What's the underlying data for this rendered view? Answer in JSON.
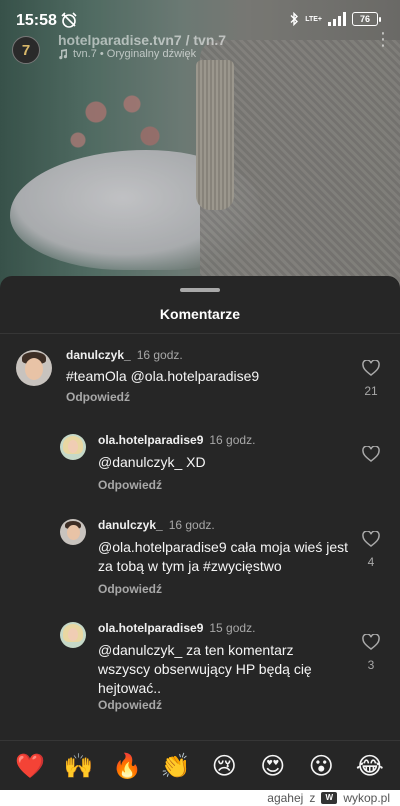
{
  "status_bar": {
    "time": "15:58",
    "network": "LTE+",
    "battery": "76"
  },
  "video": {
    "channel_badge": "7",
    "title": "hotelparadise.tvn7 / tvn.7",
    "sound_label": "tvn.7 • Oryginalny dźwięk"
  },
  "sheet": {
    "title": "Komentarze"
  },
  "comments": [
    {
      "username": "danulczyk_",
      "time": "16 godz.",
      "text": "#teamOla @ola.hotelparadise9",
      "reply_label": "Odpowiedź",
      "likes": "21"
    },
    {
      "username": "ola.hotelparadise9",
      "time": "16 godz.",
      "text": "@danulczyk_  XD",
      "reply_label": "Odpowiedź",
      "likes": ""
    },
    {
      "username": "danulczyk_",
      "time": "16 godz.",
      "text": "@ola.hotelparadise9 cała moja wieś jest za tobą w tym ja #zwycięstwo",
      "reply_label": "Odpowiedź",
      "likes": "4"
    },
    {
      "username": "ola.hotelparadise9",
      "time": "15 godz.",
      "text": "@danulczyk_ za ten komentarz wszyscy obserwujący HP będą cię hejtować..",
      "reply_label": "Odpowiedź",
      "likes": "3"
    }
  ],
  "emoji_bar": [
    "❤️",
    "🙌",
    "🔥",
    "👏",
    "😢",
    "😍",
    "😮",
    "😂"
  ],
  "footer": {
    "user": "agahej",
    "connector": "z",
    "site": "wykop.pl"
  },
  "colors": {
    "sheet_bg": "#262626",
    "secondary_text": "#a8a8a8",
    "primary_text": "#f5f5f5"
  }
}
